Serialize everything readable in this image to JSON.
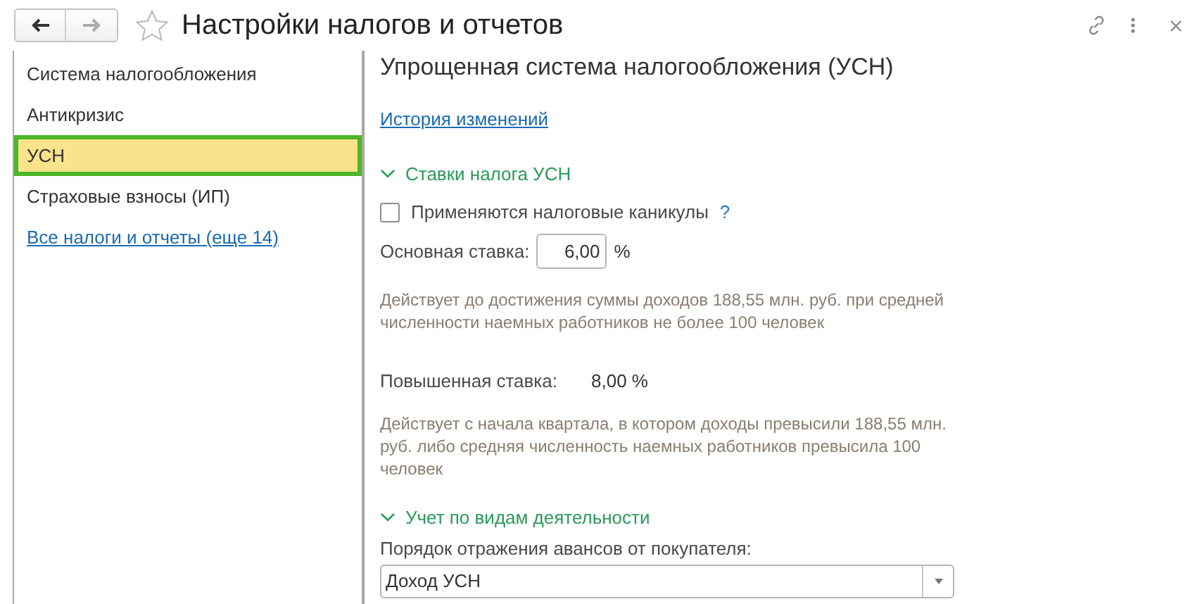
{
  "window": {
    "title": "Настройки налогов и отчетов",
    "favorite": false
  },
  "sidebar": {
    "items": [
      {
        "label": "Система налогообложения",
        "selected": false,
        "kind": "item"
      },
      {
        "label": "Антикризис",
        "selected": false,
        "kind": "item"
      },
      {
        "label": "УСН",
        "selected": true,
        "kind": "item"
      },
      {
        "label": "Страховые взносы (ИП)",
        "selected": false,
        "kind": "item"
      },
      {
        "label": "Все налоги и отчеты (еще 14)",
        "selected": false,
        "kind": "link"
      }
    ]
  },
  "content": {
    "heading": "Упрощенная система налогообложения (УСН)",
    "history_link": "История изменений",
    "sections": [
      {
        "title": "Ставки налога УСН",
        "expanded": true,
        "fields": [
          {
            "kind": "checkbox",
            "label": "Применяются налоговые каникулы",
            "checked": false,
            "help": "?"
          },
          {
            "kind": "input",
            "label": "Основная ставка:",
            "value": "6,00",
            "unit": "%"
          },
          {
            "kind": "note",
            "text": "Действует до достижения суммы доходов 188,55 млн. руб. при средней численности наемных работников не более 100 человек"
          },
          {
            "kind": "value",
            "label": "Повышенная ставка:",
            "value": "8,00 %"
          },
          {
            "kind": "note",
            "text": "Действует с начала квартала, в котором доходы превысили 188,55 млн. руб. либо средняя численность наемных работников превысила 100 человек"
          }
        ]
      },
      {
        "title": "Учет по видам деятельности",
        "expanded": true,
        "fields": [
          {
            "kind": "select",
            "label": "Порядок отражения авансов от покупателя:",
            "value": "Доход УСН"
          }
        ]
      }
    ]
  }
}
